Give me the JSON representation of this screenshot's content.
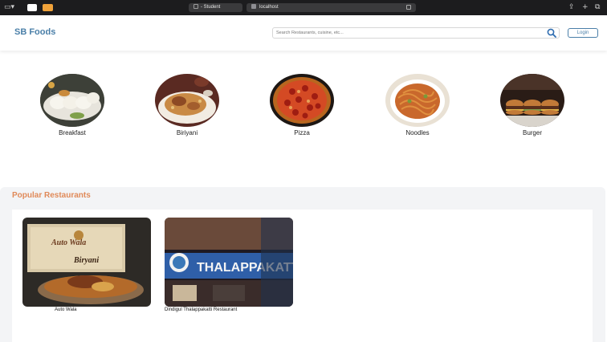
{
  "browser": {
    "tab_label": "- Student",
    "address": "localhost"
  },
  "header": {
    "logo": "SB Foods",
    "search_placeholder": "Search Restaurants, cuisine, etc...",
    "login_label": "Login"
  },
  "categories": [
    {
      "label": "Breakfast"
    },
    {
      "label": "Biriyani"
    },
    {
      "label": "Pizza"
    },
    {
      "label": "Noodles"
    },
    {
      "label": "Burger"
    }
  ],
  "popular": {
    "title": "Popular Restaurants",
    "restaurants": [
      {
        "name": "Auto Wala",
        "sign_text": "Auto Wala",
        "sub_text": "Biryani"
      },
      {
        "name": "Dindigul Thalappakatti Restaurant",
        "sign_text": "THALAPPAKATTI"
      }
    ]
  },
  "colors": {
    "brand": "#4a7fa8",
    "accent": "#e08a59"
  }
}
